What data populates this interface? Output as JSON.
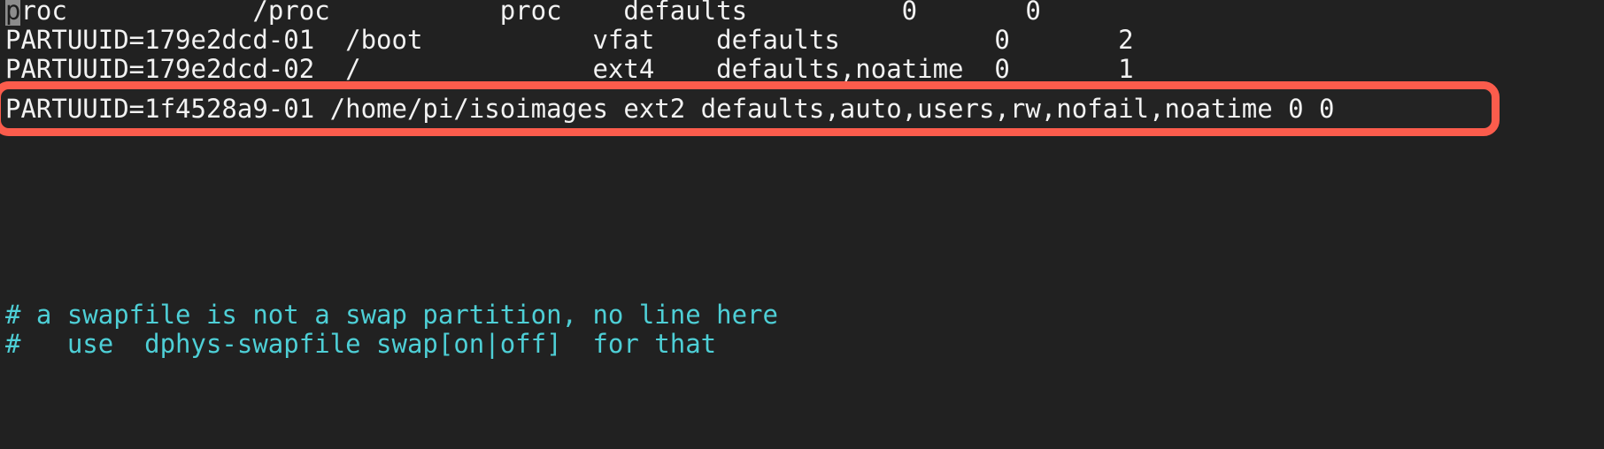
{
  "terminal": {
    "background_color": "#212121",
    "foreground_color": "#f2f2f2",
    "comment_color": "#4ecfd6",
    "highlight_color": "#fb5c4c",
    "cursor_color": "#8c8c8c",
    "font_size_px": 29
  },
  "fstab": {
    "line1": {
      "cursor_char": "p",
      "rest": "roc            /proc           proc    defaults          0       0"
    },
    "line2": "PARTUUID=179e2dcd-01  /boot           vfat    defaults          0       2",
    "line3": "PARTUUID=179e2dcd-02  /               ext4    defaults,noatime  0       1",
    "highlighted_line": "PARTUUID=1f4528a9-01 /home/pi/isoimages ext2 defaults,auto,users,rw,nofail,noatime 0 0",
    "comment1": "# a swapfile is not a swap partition, no line here",
    "comment2": "#   use  dphys-swapfile swap[on|off]  for that"
  }
}
